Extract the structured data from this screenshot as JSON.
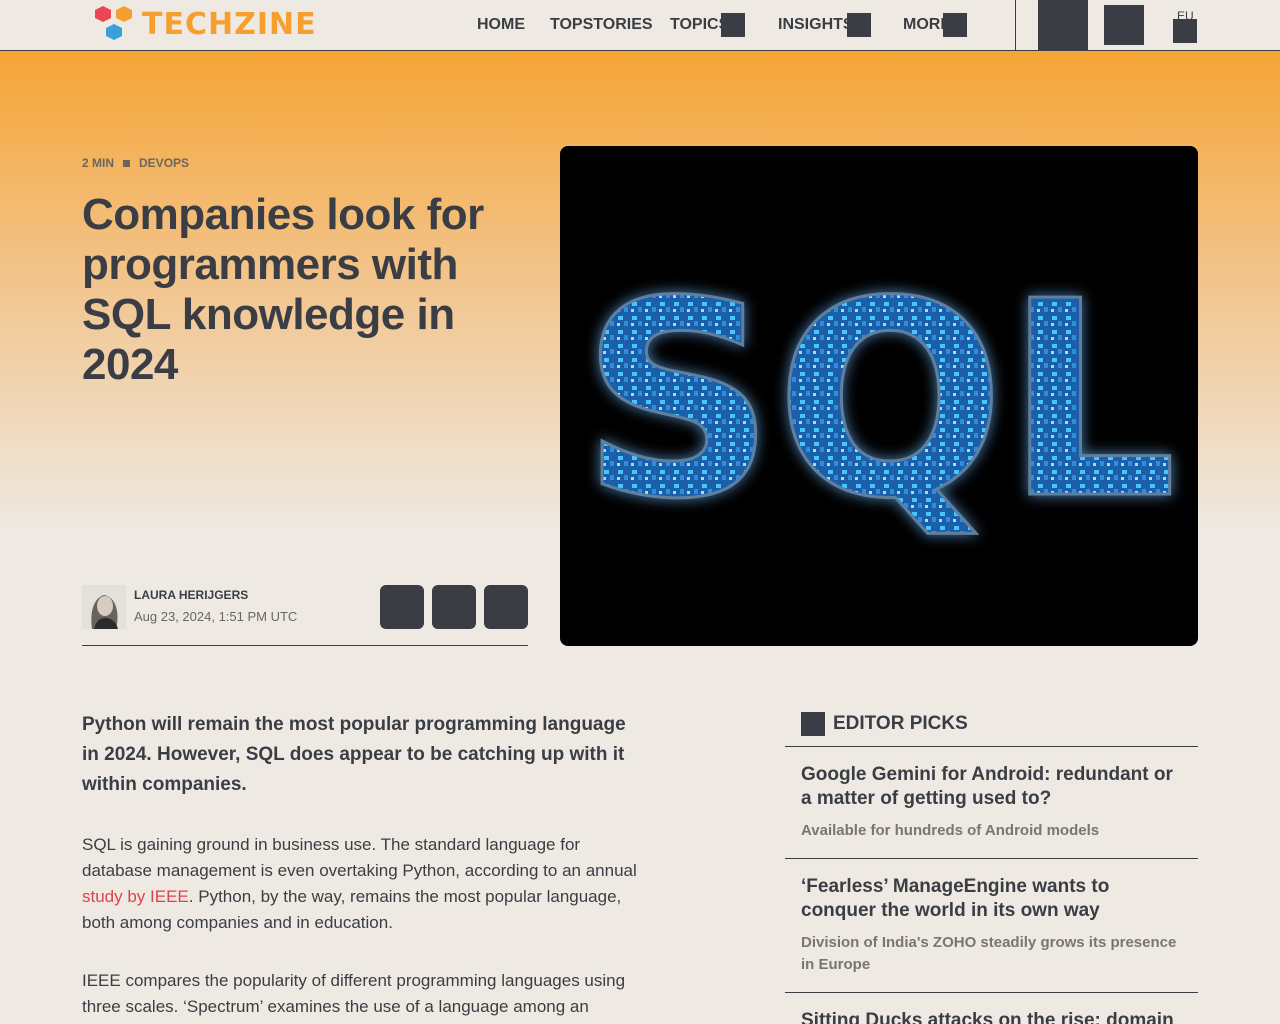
{
  "header": {
    "logo_text": "TECHZINE",
    "nav": [
      {
        "label": "HOME"
      },
      {
        "label": "TOPSTORIES"
      },
      {
        "label": "TOPICS"
      },
      {
        "label": "INSIGHTS"
      },
      {
        "label": "MORE"
      }
    ],
    "region": "EU"
  },
  "article": {
    "read_time": "2 MIN",
    "category": "DEVOPS",
    "title": "Companies look for programmers with SQL knowledge in 2024",
    "author_name": "LAURA HERIJGERS",
    "date": "Aug 23, 2024, 1:51 PM UTC",
    "image_text": "SQL",
    "lead": "Python will remain the most popular programming language in 2024. However, SQL does appear to be catching up with it within companies.",
    "p1_before": "SQL is gaining ground in business use. The standard language for database management is even overtaking Python, according to an annual ",
    "p1_link": "study by IEEE",
    "p1_after": ". Python, by the way, remains the most popular language, both among companies and in education.",
    "p2": "IEEE compares the popularity of different programming languages using three scales. ‘Spectrum’ examines the use of a language among an average"
  },
  "sidebar": {
    "title": "EDITOR PICKS",
    "picks": [
      {
        "title": "Google Gemini for Android: redundant or a matter of getting used to?",
        "subtitle": "Available for hundreds of Android models"
      },
      {
        "title": "‘Fearless’ ManageEngine wants to conquer the world in its own way",
        "subtitle": "Division of India's ZOHO steadily grows its presence in Europe"
      },
      {
        "title": "Sitting Ducks attacks on the rise: domain",
        "subtitle": ""
      }
    ]
  },
  "colors": {
    "brand_orange": "#f5a02e",
    "dark": "#3a3e44",
    "link_red": "#e0424a",
    "page_bg": "#eeeae3"
  }
}
